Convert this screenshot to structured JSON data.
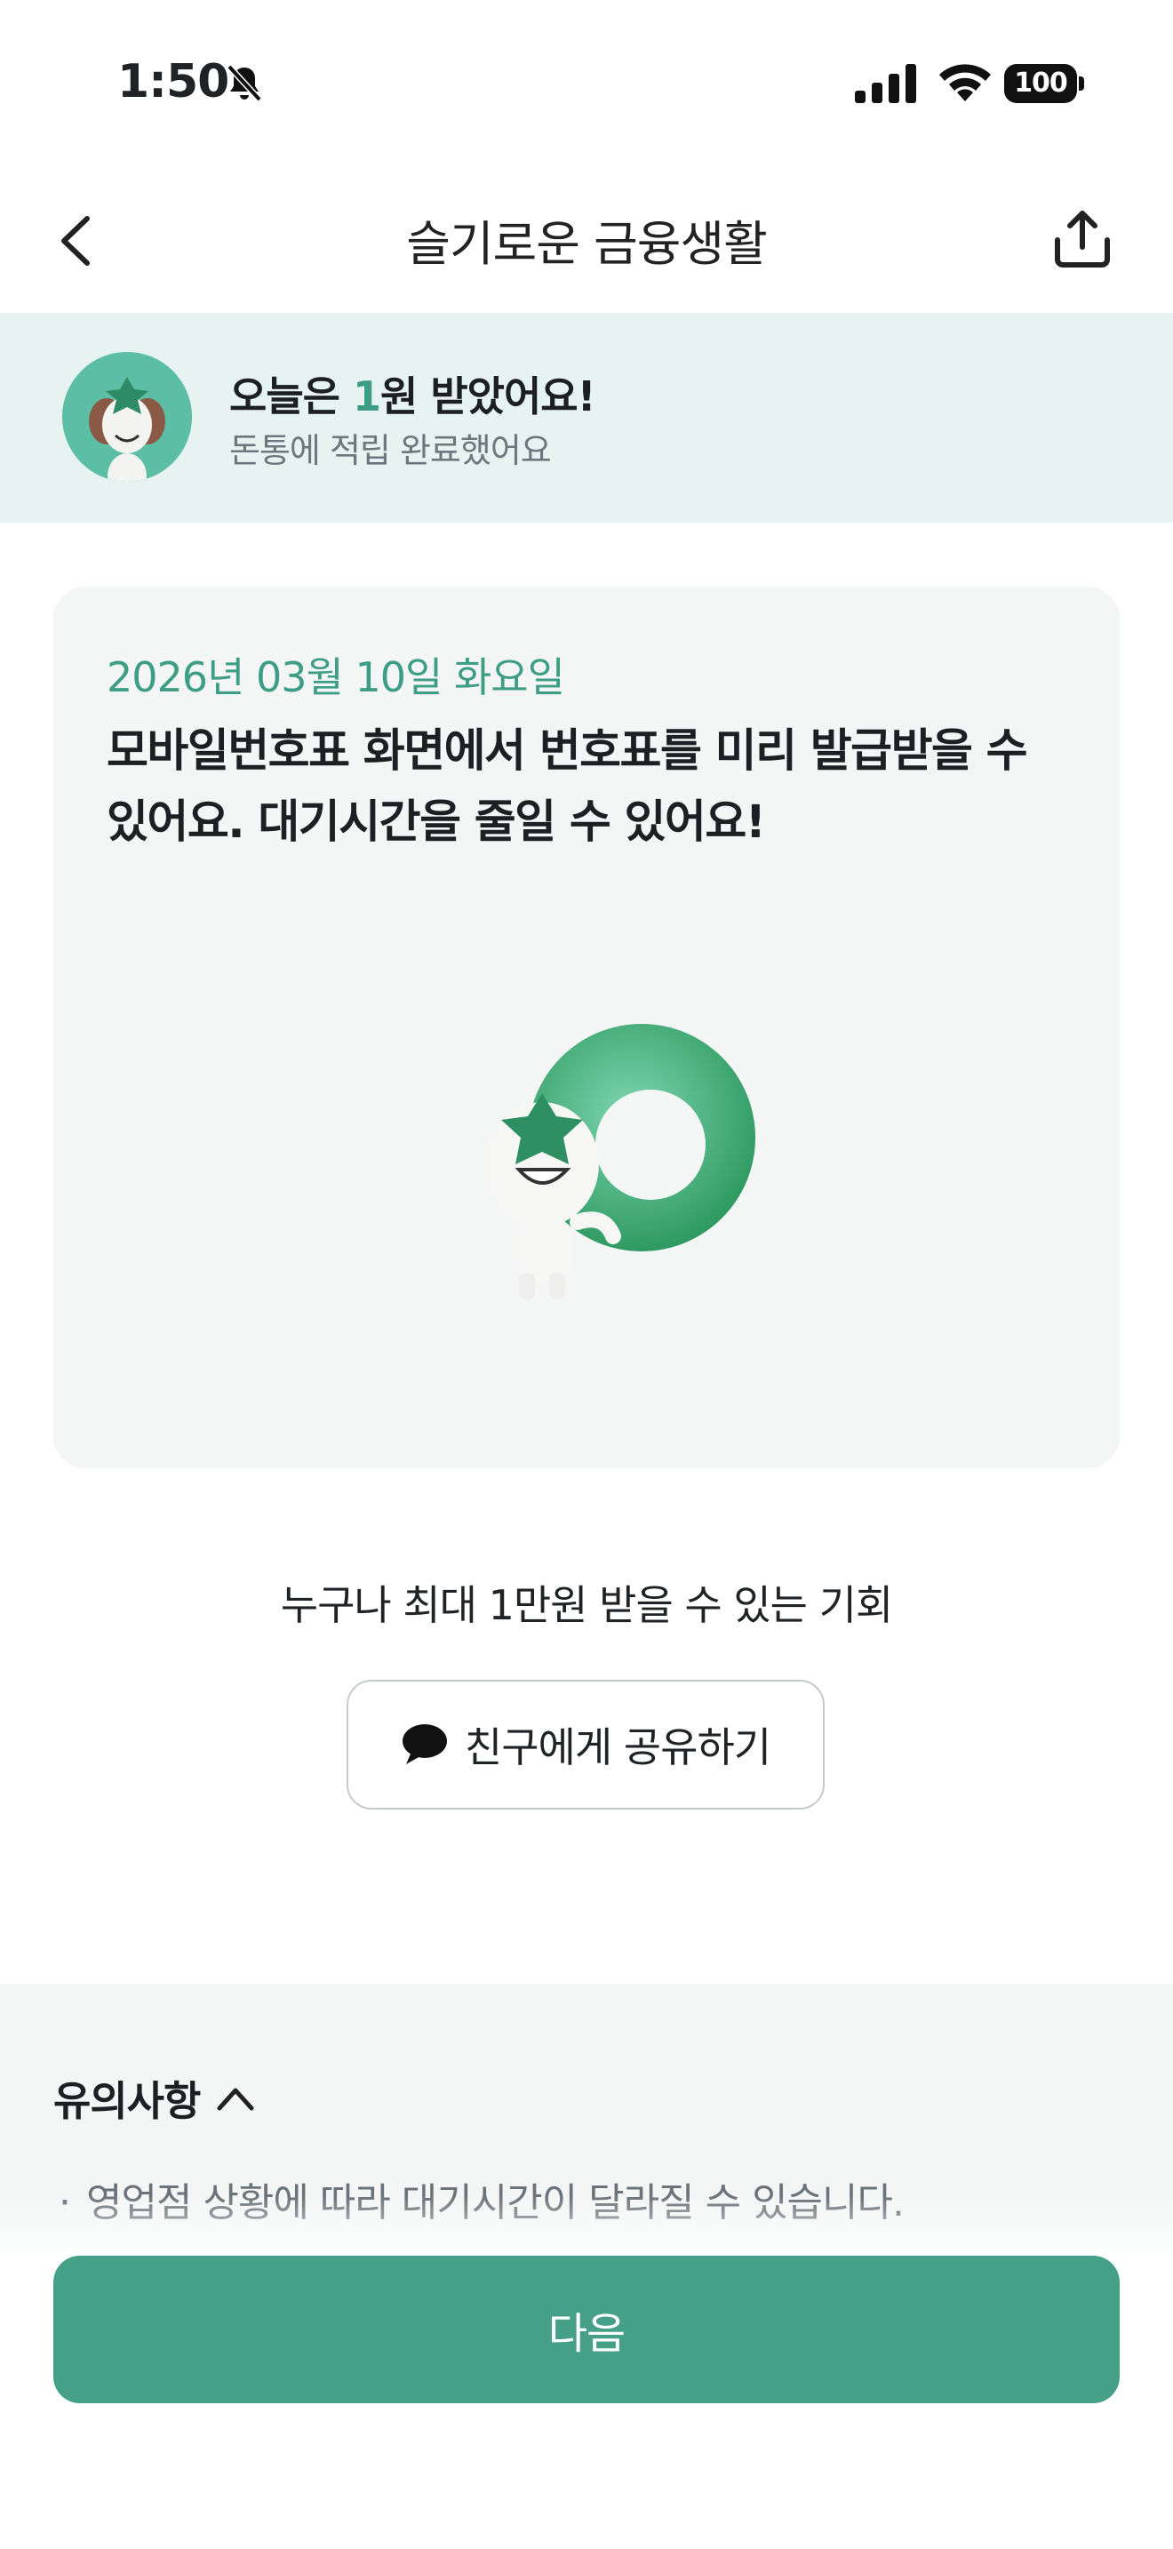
{
  "status_bar": {
    "time": "1:50",
    "battery": "100"
  },
  "nav": {
    "title": "슬기로운 금융생활"
  },
  "reward": {
    "title_prefix": "오늘은 ",
    "amount": "1",
    "title_suffix": "원 받았어요!",
    "subtitle": "돈통에 적립 완료했어요"
  },
  "tip": {
    "date": "2026년 03월 10일 화요일",
    "text": "모바일번호표 화면에서 번호표를 미리 발급받을 수 있어요. 대기시간을 줄일 수 있어요!"
  },
  "share": {
    "caption": "누구나 최대 1만원 받을 수 있는 기회",
    "button_label": "친구에게 공유하기"
  },
  "notice": {
    "title": "유의사항",
    "items": [
      "영업점 상황에 따라 대기시간이 달라질 수 있습니다."
    ]
  },
  "footer": {
    "next_label": "다음"
  },
  "colors": {
    "accent": "#46a088",
    "banner_bg": "#e6f3f1",
    "card_bg": "#f4f6f6"
  }
}
